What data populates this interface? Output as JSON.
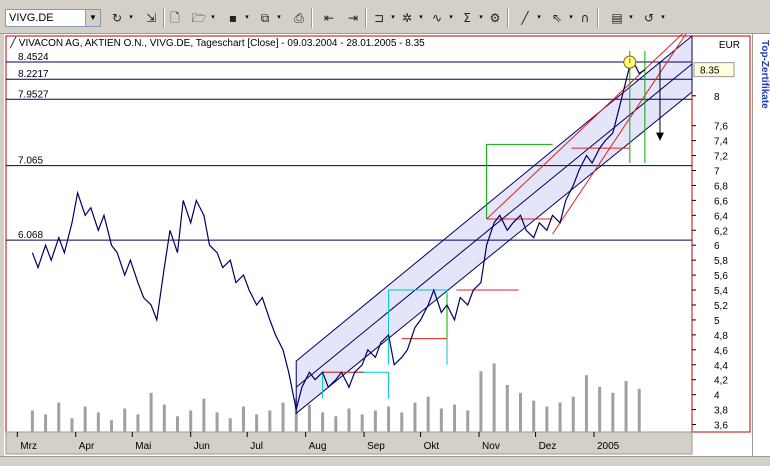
{
  "toolbar": {
    "symbol": "VIVG.DE",
    "buttons": [
      {
        "name": "refresh-icon",
        "glyph": "↻"
      },
      {
        "name": "export-icon",
        "glyph": "⇲"
      },
      {
        "name": "new-doc-icon",
        "glyph": "🗋"
      },
      {
        "name": "open-folder-icon",
        "glyph": "🗁"
      },
      {
        "name": "save-icon",
        "glyph": "▪"
      },
      {
        "name": "copy-icon",
        "glyph": "⧉"
      },
      {
        "name": "print-icon",
        "glyph": "⎙"
      },
      {
        "name": "chart-back-icon",
        "glyph": "⇤"
      },
      {
        "name": "chart-forward-icon",
        "glyph": "⇥"
      },
      {
        "name": "indicator-icon",
        "glyph": "⊐"
      },
      {
        "name": "study-icon",
        "glyph": "✲"
      },
      {
        "name": "curve-icon",
        "glyph": "∿"
      },
      {
        "name": "sum-icon",
        "glyph": "Σ"
      },
      {
        "name": "settings-icon",
        "glyph": "⚙"
      },
      {
        "name": "line-tool-icon",
        "glyph": "╱"
      },
      {
        "name": "cursor-icon",
        "glyph": "⇖"
      },
      {
        "name": "magnet-icon",
        "glyph": "∩"
      },
      {
        "name": "properties-icon",
        "glyph": "▤"
      },
      {
        "name": "reload-icon",
        "glyph": "↺"
      }
    ]
  },
  "side_tab": {
    "label": "Top-Zertifikate"
  },
  "chart_data": {
    "type": "line",
    "title": "VIVACON AG, AKTIEN O.N., VIVG.DE, Tageschart [Close] - 09.03.2004 - 28.01.2005 - 8.35",
    "currency": "EUR",
    "last_value": "8.35",
    "ylim": [
      3.5,
      8.8
    ],
    "y_ticks": [
      "3,6",
      "3,8",
      "4",
      "4,2",
      "4,4",
      "4,6",
      "4,8",
      "5",
      "5,2",
      "5,4",
      "5,6",
      "5,8",
      "6",
      "6,2",
      "6,4",
      "6,6",
      "6,8",
      "7",
      "7,2",
      "7,4",
      "7,6",
      "8"
    ],
    "y_tick_values": [
      3.6,
      3.8,
      4,
      4.2,
      4.4,
      4.6,
      4.8,
      5,
      5.2,
      5.4,
      5.6,
      5.8,
      6,
      6.2,
      6.4,
      6.6,
      6.8,
      7,
      7.2,
      7.4,
      7.6,
      8
    ],
    "x_range": [
      "2004-02-24",
      "2005-02-22"
    ],
    "x_ticks": [
      {
        "label": "Mrz",
        "date": "2004-03-01"
      },
      {
        "label": "Apr",
        "date": "2004-04-01"
      },
      {
        "label": "Mai",
        "date": "2004-05-01"
      },
      {
        "label": "Jun",
        "date": "2004-06-01"
      },
      {
        "label": "Jul",
        "date": "2004-07-01"
      },
      {
        "label": "Aug",
        "date": "2004-08-01"
      },
      {
        "label": "Sep",
        "date": "2004-09-01"
      },
      {
        "label": "Okt",
        "date": "2004-10-01"
      },
      {
        "label": "Nov",
        "date": "2004-11-01"
      },
      {
        "label": "Dez",
        "date": "2004-12-01"
      },
      {
        "label": "2005",
        "date": "2005-01-01"
      }
    ],
    "h_levels": [
      {
        "label": "8.4524",
        "value": 8.4524
      },
      {
        "label": "8.2217",
        "value": 8.2217
      },
      {
        "label": "7.9527",
        "value": 7.9527
      },
      {
        "label": "7.065",
        "value": 7.065
      },
      {
        "label": "6.068",
        "value": 6.068
      }
    ],
    "series": [
      {
        "x": [
          "2004-03-09",
          "2004-03-12",
          "2004-03-16",
          "2004-03-19",
          "2004-03-23",
          "2004-03-26",
          "2004-03-30",
          "2004-04-02",
          "2004-04-06",
          "2004-04-09",
          "2004-04-13",
          "2004-04-16",
          "2004-04-20",
          "2004-04-23",
          "2004-04-27",
          "2004-04-30",
          "2004-05-04",
          "2004-05-07",
          "2004-05-11",
          "2004-05-14",
          "2004-05-18",
          "2004-05-21",
          "2004-05-25",
          "2004-05-28",
          "2004-06-01",
          "2004-06-04",
          "2004-06-08",
          "2004-06-11",
          "2004-06-15",
          "2004-06-18",
          "2004-06-22",
          "2004-06-25",
          "2004-06-29",
          "2004-07-02",
          "2004-07-06",
          "2004-07-09",
          "2004-07-13",
          "2004-07-16",
          "2004-07-20",
          "2004-07-23",
          "2004-07-27",
          "2004-07-30",
          "2004-08-03",
          "2004-08-06",
          "2004-08-10",
          "2004-08-13",
          "2004-08-17",
          "2004-08-20",
          "2004-08-24",
          "2004-08-27",
          "2004-08-31",
          "2004-09-03",
          "2004-09-07",
          "2004-09-10",
          "2004-09-14",
          "2004-09-17",
          "2004-09-21",
          "2004-09-24",
          "2004-09-28",
          "2004-10-01",
          "2004-10-05",
          "2004-10-08",
          "2004-10-12",
          "2004-10-15",
          "2004-10-19",
          "2004-10-22",
          "2004-10-26",
          "2004-10-29",
          "2004-11-02",
          "2004-11-05",
          "2004-11-09",
          "2004-11-12",
          "2004-11-16",
          "2004-11-19",
          "2004-11-23",
          "2004-11-26",
          "2004-11-30",
          "2004-12-03",
          "2004-12-07",
          "2004-12-10",
          "2004-12-14",
          "2004-12-17",
          "2004-12-21",
          "2004-12-24",
          "2004-12-28",
          "2004-12-31",
          "2005-01-04",
          "2005-01-07",
          "2005-01-11",
          "2005-01-14",
          "2005-01-18",
          "2005-01-21",
          "2005-01-25",
          "2005-01-28"
        ],
        "y": [
          5.9,
          5.7,
          6.0,
          5.8,
          6.1,
          5.9,
          6.3,
          6.7,
          6.4,
          6.5,
          6.2,
          6.4,
          6.0,
          5.9,
          5.6,
          5.8,
          5.5,
          5.3,
          5.2,
          5.0,
          5.7,
          6.2,
          5.9,
          6.6,
          6.3,
          6.6,
          6.4,
          6.0,
          5.9,
          5.7,
          5.8,
          5.5,
          5.6,
          5.4,
          5.2,
          5.3,
          5.0,
          4.8,
          4.6,
          4.3,
          3.8,
          4.1,
          4.3,
          4.2,
          4.3,
          4.1,
          4.2,
          4.3,
          4.1,
          4.3,
          4.4,
          4.6,
          4.5,
          4.7,
          4.8,
          4.4,
          4.5,
          4.6,
          4.9,
          5.0,
          5.2,
          5.4,
          5.1,
          5.2,
          5.0,
          5.3,
          5.2,
          5.4,
          5.5,
          6.0,
          6.3,
          6.4,
          6.2,
          6.3,
          6.4,
          6.2,
          6.1,
          6.3,
          6.2,
          6.4,
          6.3,
          6.6,
          6.8,
          7.0,
          7.2,
          7.1,
          7.3,
          7.4,
          7.5,
          7.8,
          8.2,
          8.5,
          8.3,
          8.35
        ]
      }
    ],
    "volume": {
      "y_range": [
        0,
        100
      ],
      "x": [
        "2004-03-09",
        "2004-03-16",
        "2004-03-23",
        "2004-03-30",
        "2004-04-06",
        "2004-04-13",
        "2004-04-20",
        "2004-04-27",
        "2004-05-04",
        "2004-05-11",
        "2004-05-18",
        "2004-05-25",
        "2004-06-01",
        "2004-06-08",
        "2004-06-15",
        "2004-06-22",
        "2004-06-29",
        "2004-07-06",
        "2004-07-13",
        "2004-07-20",
        "2004-07-27",
        "2004-08-03",
        "2004-08-10",
        "2004-08-17",
        "2004-08-24",
        "2004-08-31",
        "2004-09-07",
        "2004-09-14",
        "2004-09-21",
        "2004-09-28",
        "2004-10-05",
        "2004-10-12",
        "2004-10-19",
        "2004-10-26",
        "2004-11-02",
        "2004-11-09",
        "2004-11-16",
        "2004-11-23",
        "2004-11-30",
        "2004-12-07",
        "2004-12-14",
        "2004-12-21",
        "2004-12-28",
        "2005-01-04",
        "2005-01-11",
        "2005-01-18",
        "2005-01-25"
      ],
      "values": [
        22,
        18,
        30,
        14,
        26,
        20,
        12,
        24,
        18,
        40,
        28,
        16,
        22,
        34,
        20,
        14,
        26,
        18,
        22,
        30,
        34,
        28,
        20,
        16,
        24,
        18,
        22,
        26,
        20,
        30,
        36,
        24,
        28,
        22,
        62,
        70,
        48,
        40,
        32,
        26,
        30,
        36,
        58,
        46,
        40,
        52,
        44
      ]
    },
    "channel": {
      "lower": [
        [
          "2004-07-27",
          3.75
        ],
        [
          "2005-02-22",
          8.05
        ]
      ],
      "upper": [
        [
          "2004-07-27",
          4.45
        ],
        [
          "2005-02-22",
          8.8
        ]
      ]
    },
    "annotations": {
      "green_rect": {
        "x": [
          "2004-11-05",
          "2004-12-10"
        ],
        "y": [
          6.35,
          7.35
        ]
      },
      "cyan_rect_1": {
        "x": [
          "2004-08-10",
          "2004-09-14"
        ],
        "y": [
          3.95,
          4.3
        ]
      },
      "cyan_rect_2": {
        "x": [
          "2004-09-14",
          "2004-10-15"
        ],
        "y": [
          4.4,
          5.4
        ]
      },
      "green_vline": {
        "x": "2004-10-15",
        "y": [
          4.75,
          5.35
        ]
      },
      "red_hline_1": {
        "x": [
          "2004-08-10",
          "2004-09-01"
        ],
        "y": 4.3
      },
      "red_hline_2": {
        "x": [
          "2004-09-21",
          "2004-10-15"
        ],
        "y": 4.75
      },
      "red_hline_3": {
        "x": [
          "2004-10-20",
          "2004-11-22"
        ],
        "y": 5.4
      },
      "red_hline_4": {
        "x": [
          "2004-11-05",
          "2004-12-10"
        ],
        "y": 6.35
      },
      "red_hline_5": {
        "x": [
          "2004-12-20",
          "2005-01-20"
        ],
        "y": 7.3
      },
      "fan_lines": [
        [
          [
            "2004-11-05",
            6.35
          ],
          [
            "2005-02-22",
            8.95
          ]
        ],
        [
          [
            "2004-12-10",
            6.15
          ],
          [
            "2005-02-22",
            8.95
          ]
        ]
      ],
      "green_vlines": [
        {
          "x": "2005-01-20",
          "y": [
            7.1,
            8.6
          ]
        },
        {
          "x": "2005-01-28",
          "y": [
            7.1,
            8.6
          ]
        }
      ],
      "down_arrow": {
        "x": "2005-02-05",
        "y": [
          8.45,
          7.4
        ]
      },
      "circle_marker": {
        "x": "2005-01-20",
        "y": 8.45
      }
    }
  }
}
